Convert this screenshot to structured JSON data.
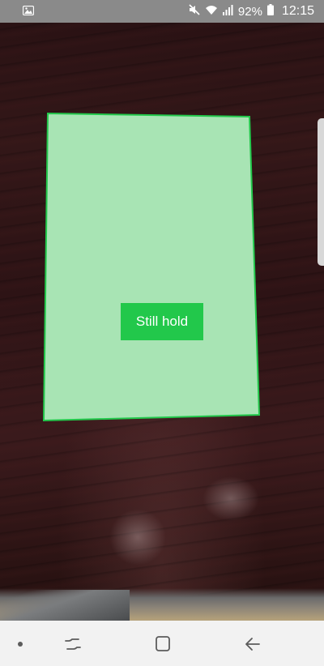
{
  "status_bar": {
    "battery_percent": "92%",
    "time": "12:15",
    "icons": [
      "image-notification-icon",
      "mute-icon",
      "wifi-icon",
      "signal-icon",
      "battery-icon"
    ]
  },
  "scanner": {
    "instruction": "Still hold",
    "overlay_color": "#a8e4b4",
    "outline_color": "#22c84b"
  },
  "nav_bar": {
    "icons": [
      "dot-indicator-icon",
      "recent-apps-icon",
      "home-icon",
      "back-icon"
    ]
  }
}
